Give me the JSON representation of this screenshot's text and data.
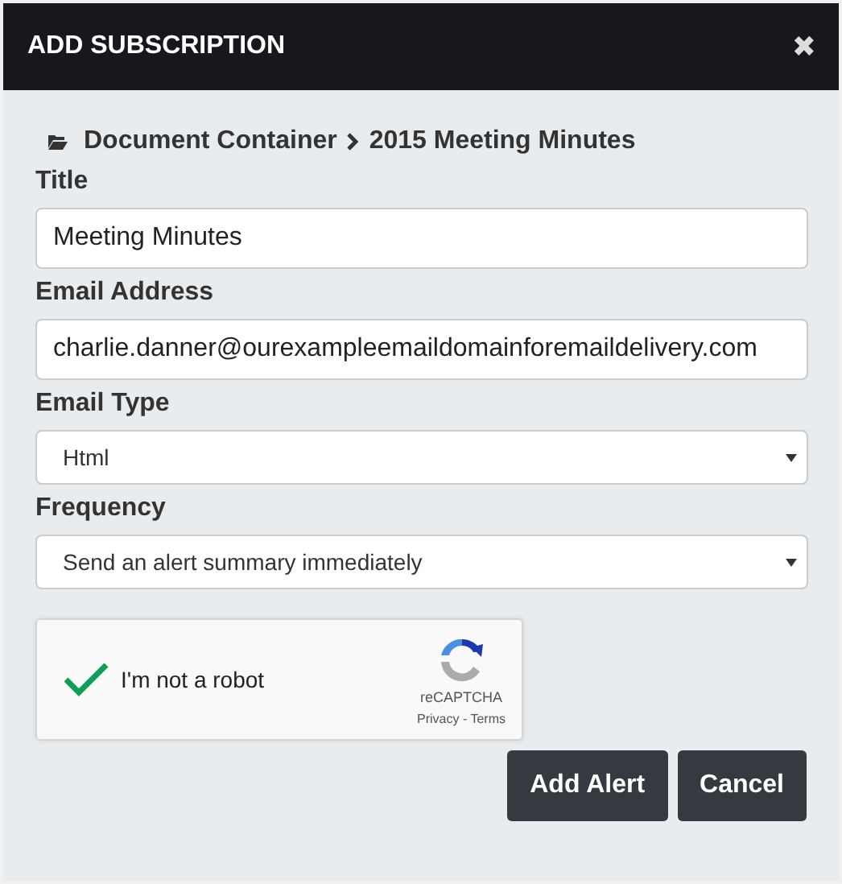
{
  "dialog": {
    "title": "ADD SUBSCRIPTION",
    "close": "✖"
  },
  "breadcrumb": [
    "Document Container",
    "2015 Meeting Minutes"
  ],
  "fields": [
    {
      "kind": "input",
      "label": "Title",
      "value": "Meeting Minutes"
    },
    {
      "kind": "input",
      "label": "Email Address",
      "value": "charlie.danner@ourexampleemaildomainforemaildelivery.com"
    },
    {
      "kind": "select",
      "label": "Email Type",
      "value": "Html"
    },
    {
      "kind": "select",
      "label": "Frequency",
      "value": "Send an alert summary immediately"
    }
  ],
  "captcha": {
    "label": "I'm not a robot",
    "checked": true,
    "brand": "reCAPTCHA",
    "links": [
      "Privacy",
      "Terms"
    ],
    "separator": " - "
  },
  "buttons": [
    "Add Alert",
    "Cancel"
  ]
}
